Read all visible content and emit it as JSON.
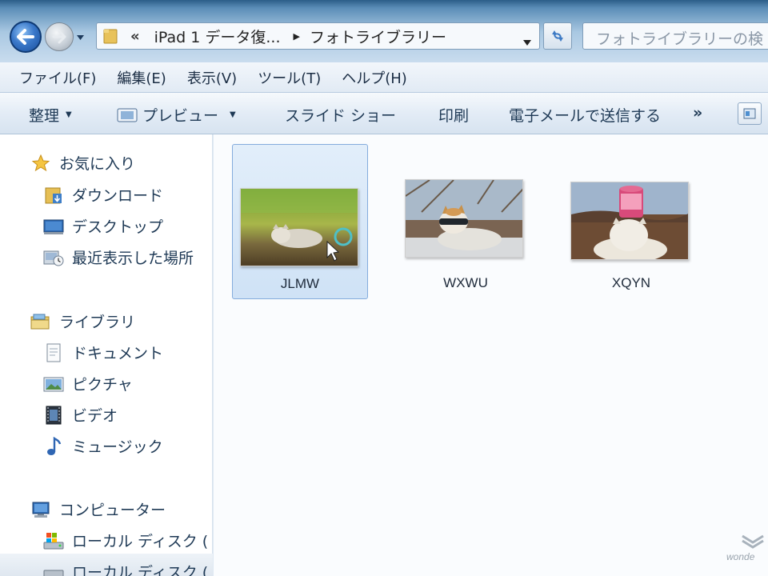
{
  "address_bar": {
    "overflow_chevron": "«",
    "breadcrumbs": [
      "iPad 1 データ復...",
      "フォトライブラリー"
    ]
  },
  "search": {
    "placeholder": "フォトライブラリーの検"
  },
  "menu": [
    "ファイル(F)",
    "編集(E)",
    "表示(V)",
    "ツール(T)",
    "ヘルプ(H)"
  ],
  "toolbar": {
    "organize": "整理",
    "preview": "プレビュー",
    "slideshow": "スライド ショー",
    "print": "印刷",
    "email": "電子メールで送信する",
    "more": "»"
  },
  "nav_pane": {
    "favorites": {
      "title": "お気に入り",
      "items": [
        "ダウンロード",
        "デスクトップ",
        "最近表示した場所"
      ]
    },
    "libraries": {
      "title": "ライブラリ",
      "items": [
        "ドキュメント",
        "ピクチャ",
        "ビデオ",
        "ミュージック"
      ]
    },
    "computer": {
      "title": "コンピューター",
      "items": [
        "ローカル ディスク (",
        "ローカル ディスク ("
      ]
    }
  },
  "files": [
    {
      "name": "JLMW",
      "selected": true
    },
    {
      "name": "WXWU",
      "selected": false
    },
    {
      "name": "XQYN",
      "selected": false
    }
  ],
  "watermark": "wonde",
  "colors": {
    "selection_fill": "#cfe2f6",
    "selection_border": "#84acdd",
    "text": "#1e3955"
  }
}
